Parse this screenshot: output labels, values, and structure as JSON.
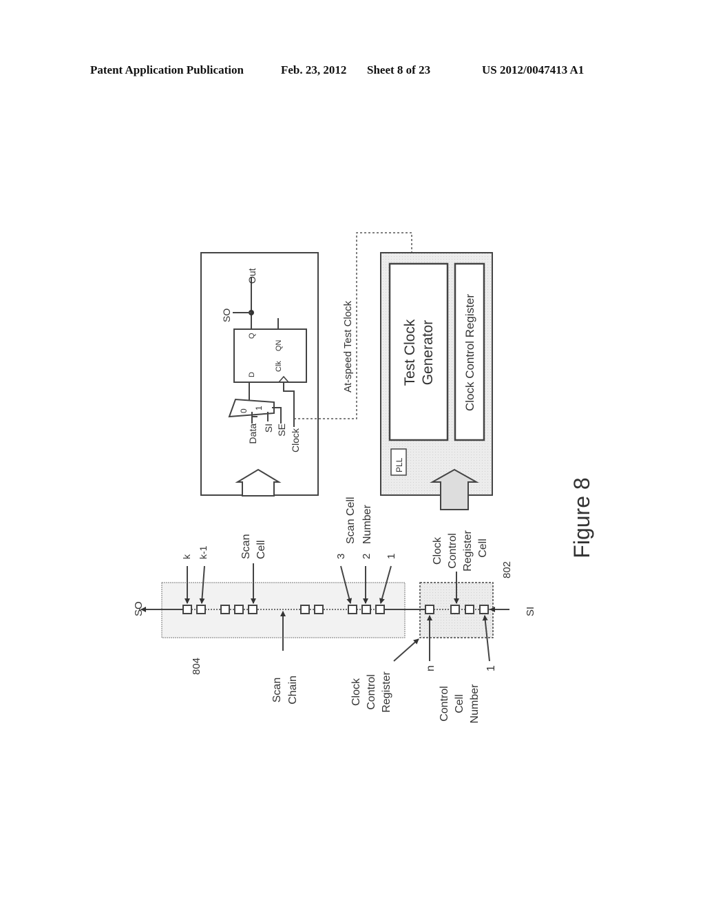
{
  "header": {
    "publication": "Patent Application Publication",
    "date": "Feb. 23, 2012",
    "sheet": "Sheet 8 of 23",
    "number": "US 2012/0047413 A1"
  },
  "figure": {
    "caption": "Figure 8",
    "scan_cell_block": {
      "inputs": [
        "Data",
        "SI",
        "SE",
        "Clock"
      ],
      "mux_inputs": [
        "0",
        "1"
      ],
      "flipflop_pins": {
        "d": "D",
        "q": "Q",
        "clk": "Clk",
        "qn": "QN"
      },
      "outputs": [
        "SO",
        "Out"
      ]
    },
    "clock_link_label": "At-speed Test Clock",
    "clock_block": {
      "pll": "PLL",
      "generator_line1": "Test Clock",
      "generator_line2": "Generator",
      "register": "Clock Control Register"
    },
    "chain": {
      "so_label": "SO",
      "si_label": "SI",
      "ref_scan_chain": "804",
      "ref_control_register": "802",
      "cell_labels": {
        "k": "k",
        "k_minus_1": "k-1",
        "n3": "3",
        "n2": "2",
        "n1": "1"
      },
      "scan_cell_label": [
        "Scan",
        "Cell"
      ],
      "scan_cell_number_label": [
        "Scan Cell",
        "Number"
      ],
      "scan_chain_label": [
        "Scan",
        "Chain"
      ],
      "clock_control_register_label": [
        "Clock",
        "Control",
        "Register"
      ],
      "clock_control_register_cell_label": [
        "Clock",
        "Control",
        "Register",
        "Cell"
      ],
      "control_cell_n": "n",
      "control_cell_1": "1",
      "control_cell_number_label": [
        "Control",
        "Cell",
        "Number"
      ]
    }
  }
}
